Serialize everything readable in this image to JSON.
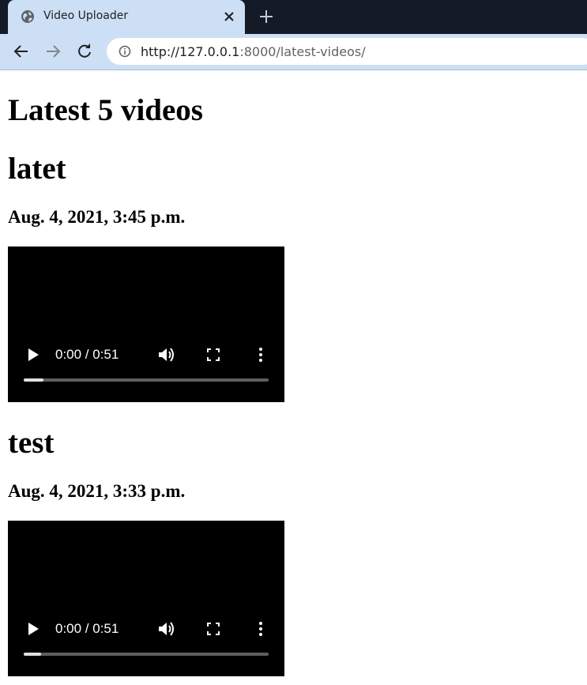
{
  "browser": {
    "tab_title": "Video Uploader",
    "url_host": "http://127.0.0.1",
    "url_rest": ":8000/latest-videos/"
  },
  "page": {
    "title": "Latest 5 videos",
    "videos": [
      {
        "title": "latet",
        "date": "Aug. 4, 2021, 3:45 p.m.",
        "time_display": "0:00 / 0:51",
        "buffered_fraction": 0.08
      },
      {
        "title": "test",
        "date": "Aug. 4, 2021, 3:33 p.m.",
        "time_display": "0:00 / 0:51",
        "buffered_fraction": 0.07
      }
    ]
  }
}
